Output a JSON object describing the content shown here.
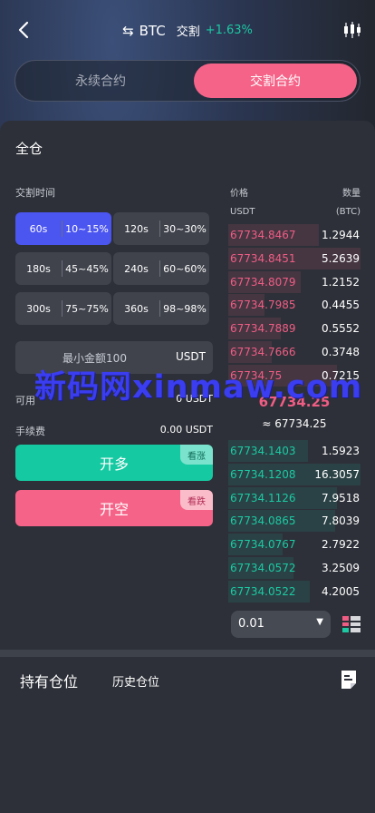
{
  "header": {
    "swap_icon": "⇆",
    "symbol": "BTC",
    "type_label": "交割",
    "change": "+1.63%",
    "colors": {
      "up": "#1cc9a3",
      "down": "#f05d84",
      "accent": "#f56488",
      "active": "#4b55f0"
    }
  },
  "mode_tabs": [
    "永续合约",
    "交割合约"
  ],
  "panel": {
    "title": "全仓",
    "delivery_label": "交割时间",
    "durations": [
      {
        "time": "60s",
        "range": "10~15%",
        "active": true
      },
      {
        "time": "120s",
        "range": "30~30%"
      },
      {
        "time": "180s",
        "range": "45~45%"
      },
      {
        "time": "240s",
        "range": "60~60%"
      },
      {
        "time": "300s",
        "range": "75~75%"
      },
      {
        "time": "360s",
        "range": "98~98%"
      }
    ],
    "amount_placeholder": "最小金额100",
    "amount_unit": "USDT",
    "available_label": "可用",
    "available_value": "0 USDT",
    "fee_label": "手续费",
    "fee_value": "0.00 USDT",
    "long_label": "开多",
    "long_tag": "看涨",
    "short_label": "开空",
    "short_tag": "看跌"
  },
  "orderbook": {
    "price_label": "价格",
    "qty_label": "数量",
    "price_unit": "USDT",
    "qty_unit": "(BTC)",
    "asks": [
      {
        "price": "67734.8467",
        "qty": "1.2944"
      },
      {
        "price": "67734.8451",
        "qty": "5.2639"
      },
      {
        "price": "67734.8079",
        "qty": "1.2152"
      },
      {
        "price": "67734.7985",
        "qty": "0.4455"
      },
      {
        "price": "67734.7889",
        "qty": "0.5552"
      },
      {
        "price": "67734.7666",
        "qty": "0.3748"
      },
      {
        "price": "67734.75",
        "qty": "0.7215"
      }
    ],
    "mid_price": "67734.25",
    "mid_approx": "≈ 67734.25",
    "bids": [
      {
        "price": "67734.1403",
        "qty": "1.5923"
      },
      {
        "price": "67734.1208",
        "qty": "16.3057"
      },
      {
        "price": "67734.1126",
        "qty": "7.9518"
      },
      {
        "price": "67734.0865",
        "qty": "7.8039"
      },
      {
        "price": "67734.0767",
        "qty": "2.7922"
      },
      {
        "price": "67734.0572",
        "qty": "3.2509"
      },
      {
        "price": "67734.0522",
        "qty": "4.2005"
      }
    ],
    "depth_value": "0.01",
    "depth_caret": "▼"
  },
  "positions": {
    "tab_holding": "持有仓位",
    "tab_history": "历史仓位"
  },
  "watermark": "新码网xinmaw.com"
}
